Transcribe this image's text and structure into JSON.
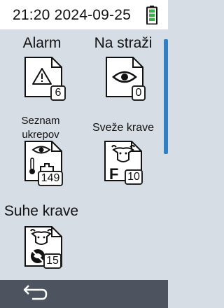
{
  "status_bar": {
    "datetime": "21:20 2024-09-25",
    "battery_icon": "battery-full-icon",
    "battery_color": "#3cb14a"
  },
  "tiles": [
    {
      "label": "Alarm",
      "icon": "alarm-warning-icon",
      "count": "6"
    },
    {
      "label": "Na straži",
      "icon": "eye-watch-icon",
      "count": "0"
    },
    {
      "label_line1": "Seznam",
      "label_line2": "ukrepov",
      "icon": "action-list-icon",
      "count": "149"
    },
    {
      "label": "Sveže krave",
      "icon": "fresh-cow-icon",
      "icon_letter": "F",
      "count": "10"
    },
    {
      "label": "Suhe krave",
      "icon": "dry-cow-icon",
      "count": "15"
    }
  ],
  "bottom_bar": {
    "back_icon": "back-arrow-icon"
  },
  "colors": {
    "accent": "#2f7fc2",
    "background": "#d6dde5",
    "bottom_bar": "#4d5460"
  }
}
